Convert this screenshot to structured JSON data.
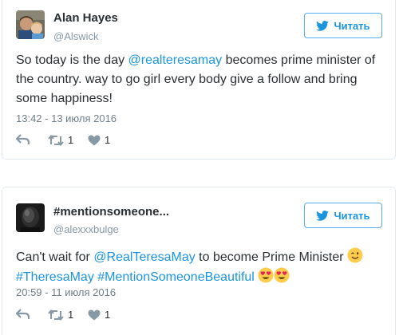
{
  "follow_label": "Читать",
  "tweets": [
    {
      "name": "Alan Hayes",
      "handle": "@Alswick",
      "text_before": "So today is the day ",
      "mention": "@realteresamay",
      "text_after": " becomes prime minister of the country. way to go girl every body give a follow and bring some happiness!",
      "timestamp": "13:42 - 13 июля 2016",
      "retweets": "1",
      "likes": "1"
    },
    {
      "name": "#mentionsomeone...",
      "handle": "@alexxxbulge",
      "text_before": "Can't wait for ",
      "mention": "@RealTeresaMay",
      "text_after": " to become Prime Minister ",
      "hashtag1": "#TheresaMay",
      "hashtag2": "#MentionSomeoneBeautiful",
      "timestamp": "20:59 - 11 июля 2016",
      "retweets": "1",
      "likes": "1"
    }
  ],
  "colors": {
    "accent": "#1b95e0",
    "border": "#e1e8ed",
    "text": "#292f33",
    "muted": "#8899a6"
  },
  "icons": [
    "twitter-bird-icon",
    "reply-icon",
    "retweet-icon",
    "heart-icon",
    "winking-face-emoji",
    "heart-eyes-emoji"
  ]
}
